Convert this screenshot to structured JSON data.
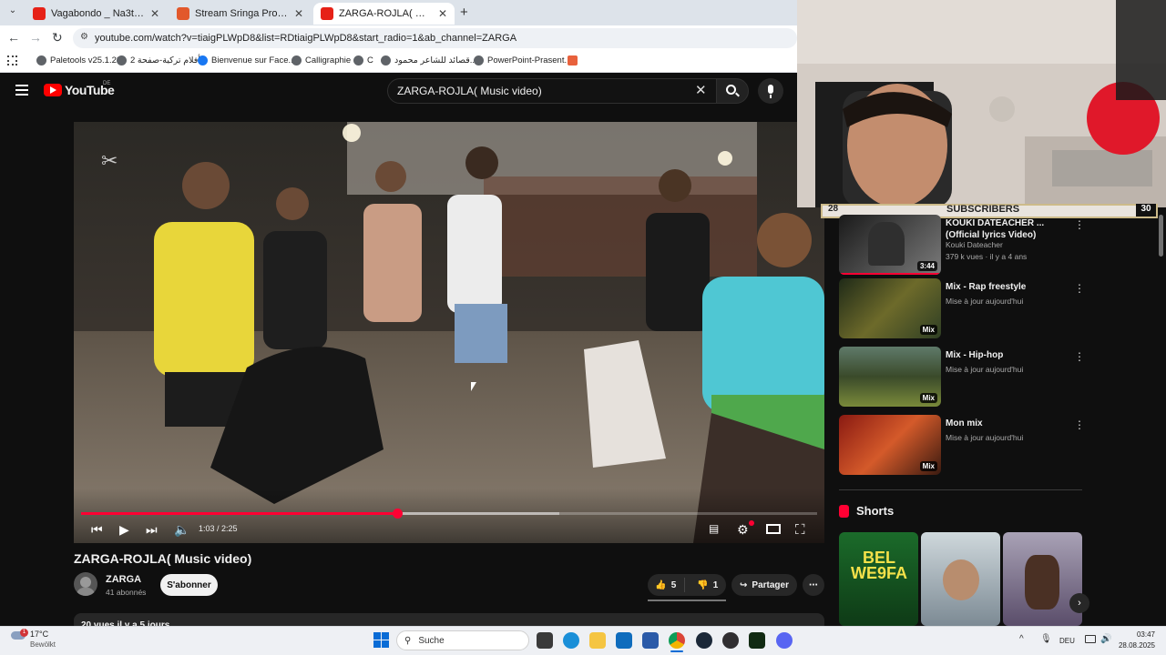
{
  "browser": {
    "tabs": [
      {
        "label": "Vagabondo _ Na3ti dom nkassa",
        "active": false
      },
      {
        "label": "Stream Sringa Project music | L",
        "active": false
      },
      {
        "label": "ZARGA-ROJLA( Music video",
        "active": true
      }
    ],
    "url": "youtube.com/watch?v=tiaigPLWpD8&list=RDtiaigPLWpD8&start_radio=1&ab_channel=ZARGA",
    "bookmarks": [
      "Paletools v25.1.23",
      "أفلام تركية-صفحة 2",
      "Bienvenue sur Face...",
      "Calligraphie",
      "C",
      "قصائد للشاعر محمود...",
      "PowerPoint-Prasent..."
    ]
  },
  "youtube": {
    "logo": "YouTube",
    "region": "DE",
    "search_value": "ZARGA-ROJLA( Music video)",
    "player": {
      "time": "1:03 / 2:25",
      "progress": 0.43,
      "buffered": 0.65
    },
    "video_title": "ZARGA-ROJLA( Music video)",
    "channel": {
      "name": "ZARGA",
      "subs": "41 abonnés",
      "subscribe": "S'abonner"
    },
    "likes": "5",
    "dislikes": "1",
    "share": "Partager",
    "description_peek": "20 vues  il y a 5 jours"
  },
  "overlay": {
    "left": "28",
    "center": "SUBSCRIBERS",
    "right": "30"
  },
  "recommendations": [
    {
      "title": "KOUKI DATEACHER ... (Official lyrics Video)",
      "meta1": "Kouki Dateacher",
      "meta2": "379 k vues · il y a 4 ans",
      "badge": "3:44"
    },
    {
      "title": "Mix - Rap freestyle",
      "meta1": "Mise à jour aujourd'hui",
      "meta2": "",
      "badge": "Mix"
    },
    {
      "title": "Mix - Hip-hop",
      "meta1": "Mise à jour aujourd'hui",
      "meta2": "",
      "badge": "Mix"
    },
    {
      "title": "Mon mix",
      "meta1": "Mise à jour aujourd'hui",
      "meta2": "",
      "badge": "Mix"
    }
  ],
  "shorts": {
    "heading": "Shorts",
    "first_text": "BEL WE9FA"
  },
  "taskbar": {
    "weather_temp": "17°C",
    "weather_desc": "Bewölkt",
    "search": "Suche",
    "lang": "DEU",
    "time": "03:47",
    "date": "28.08.2025"
  }
}
